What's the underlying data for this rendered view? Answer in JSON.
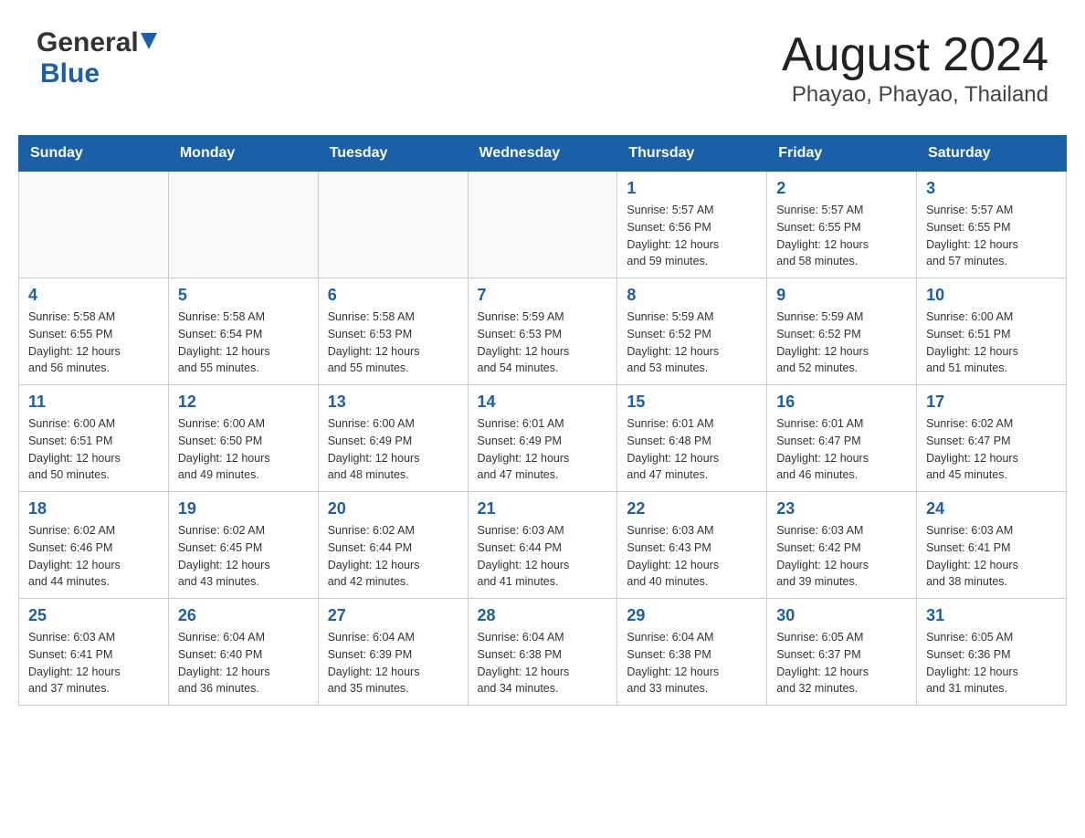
{
  "header": {
    "logo_general": "General",
    "logo_blue": "Blue",
    "title": "August 2024",
    "subtitle": "Phayao, Phayao, Thailand"
  },
  "weekdays": [
    "Sunday",
    "Monday",
    "Tuesday",
    "Wednesday",
    "Thursday",
    "Friday",
    "Saturday"
  ],
  "weeks": [
    [
      {
        "day": "",
        "info": ""
      },
      {
        "day": "",
        "info": ""
      },
      {
        "day": "",
        "info": ""
      },
      {
        "day": "",
        "info": ""
      },
      {
        "day": "1",
        "info": "Sunrise: 5:57 AM\nSunset: 6:56 PM\nDaylight: 12 hours\nand 59 minutes."
      },
      {
        "day": "2",
        "info": "Sunrise: 5:57 AM\nSunset: 6:55 PM\nDaylight: 12 hours\nand 58 minutes."
      },
      {
        "day": "3",
        "info": "Sunrise: 5:57 AM\nSunset: 6:55 PM\nDaylight: 12 hours\nand 57 minutes."
      }
    ],
    [
      {
        "day": "4",
        "info": "Sunrise: 5:58 AM\nSunset: 6:55 PM\nDaylight: 12 hours\nand 56 minutes."
      },
      {
        "day": "5",
        "info": "Sunrise: 5:58 AM\nSunset: 6:54 PM\nDaylight: 12 hours\nand 55 minutes."
      },
      {
        "day": "6",
        "info": "Sunrise: 5:58 AM\nSunset: 6:53 PM\nDaylight: 12 hours\nand 55 minutes."
      },
      {
        "day": "7",
        "info": "Sunrise: 5:59 AM\nSunset: 6:53 PM\nDaylight: 12 hours\nand 54 minutes."
      },
      {
        "day": "8",
        "info": "Sunrise: 5:59 AM\nSunset: 6:52 PM\nDaylight: 12 hours\nand 53 minutes."
      },
      {
        "day": "9",
        "info": "Sunrise: 5:59 AM\nSunset: 6:52 PM\nDaylight: 12 hours\nand 52 minutes."
      },
      {
        "day": "10",
        "info": "Sunrise: 6:00 AM\nSunset: 6:51 PM\nDaylight: 12 hours\nand 51 minutes."
      }
    ],
    [
      {
        "day": "11",
        "info": "Sunrise: 6:00 AM\nSunset: 6:51 PM\nDaylight: 12 hours\nand 50 minutes."
      },
      {
        "day": "12",
        "info": "Sunrise: 6:00 AM\nSunset: 6:50 PM\nDaylight: 12 hours\nand 49 minutes."
      },
      {
        "day": "13",
        "info": "Sunrise: 6:00 AM\nSunset: 6:49 PM\nDaylight: 12 hours\nand 48 minutes."
      },
      {
        "day": "14",
        "info": "Sunrise: 6:01 AM\nSunset: 6:49 PM\nDaylight: 12 hours\nand 47 minutes."
      },
      {
        "day": "15",
        "info": "Sunrise: 6:01 AM\nSunset: 6:48 PM\nDaylight: 12 hours\nand 47 minutes."
      },
      {
        "day": "16",
        "info": "Sunrise: 6:01 AM\nSunset: 6:47 PM\nDaylight: 12 hours\nand 46 minutes."
      },
      {
        "day": "17",
        "info": "Sunrise: 6:02 AM\nSunset: 6:47 PM\nDaylight: 12 hours\nand 45 minutes."
      }
    ],
    [
      {
        "day": "18",
        "info": "Sunrise: 6:02 AM\nSunset: 6:46 PM\nDaylight: 12 hours\nand 44 minutes."
      },
      {
        "day": "19",
        "info": "Sunrise: 6:02 AM\nSunset: 6:45 PM\nDaylight: 12 hours\nand 43 minutes."
      },
      {
        "day": "20",
        "info": "Sunrise: 6:02 AM\nSunset: 6:44 PM\nDaylight: 12 hours\nand 42 minutes."
      },
      {
        "day": "21",
        "info": "Sunrise: 6:03 AM\nSunset: 6:44 PM\nDaylight: 12 hours\nand 41 minutes."
      },
      {
        "day": "22",
        "info": "Sunrise: 6:03 AM\nSunset: 6:43 PM\nDaylight: 12 hours\nand 40 minutes."
      },
      {
        "day": "23",
        "info": "Sunrise: 6:03 AM\nSunset: 6:42 PM\nDaylight: 12 hours\nand 39 minutes."
      },
      {
        "day": "24",
        "info": "Sunrise: 6:03 AM\nSunset: 6:41 PM\nDaylight: 12 hours\nand 38 minutes."
      }
    ],
    [
      {
        "day": "25",
        "info": "Sunrise: 6:03 AM\nSunset: 6:41 PM\nDaylight: 12 hours\nand 37 minutes."
      },
      {
        "day": "26",
        "info": "Sunrise: 6:04 AM\nSunset: 6:40 PM\nDaylight: 12 hours\nand 36 minutes."
      },
      {
        "day": "27",
        "info": "Sunrise: 6:04 AM\nSunset: 6:39 PM\nDaylight: 12 hours\nand 35 minutes."
      },
      {
        "day": "28",
        "info": "Sunrise: 6:04 AM\nSunset: 6:38 PM\nDaylight: 12 hours\nand 34 minutes."
      },
      {
        "day": "29",
        "info": "Sunrise: 6:04 AM\nSunset: 6:38 PM\nDaylight: 12 hours\nand 33 minutes."
      },
      {
        "day": "30",
        "info": "Sunrise: 6:05 AM\nSunset: 6:37 PM\nDaylight: 12 hours\nand 32 minutes."
      },
      {
        "day": "31",
        "info": "Sunrise: 6:05 AM\nSunset: 6:36 PM\nDaylight: 12 hours\nand 31 minutes."
      }
    ]
  ]
}
